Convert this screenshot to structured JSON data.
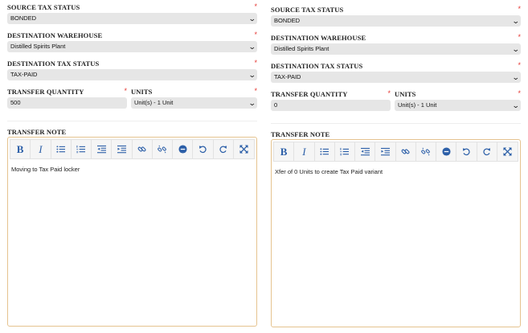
{
  "left": {
    "source_tax_status": {
      "label": "SOURCE TAX STATUS",
      "value": "BONDED"
    },
    "destination_warehouse": {
      "label": "DESTINATION WAREHOUSE",
      "value": "Distilled Spirits Plant"
    },
    "destination_tax_status": {
      "label": "DESTINATION TAX STATUS",
      "value": "TAX-PAID"
    },
    "transfer_quantity": {
      "label": "TRANSFER QUANTITY",
      "value": "500"
    },
    "units": {
      "label": "UNITS",
      "value": "Unit(s) - 1 Unit"
    },
    "transfer_note": {
      "label": "TRANSFER NOTE",
      "content": "Moving to Tax Paid locker"
    }
  },
  "right": {
    "source_tax_status": {
      "label": "SOURCE TAX STATUS",
      "value": "BONDED"
    },
    "destination_warehouse": {
      "label": "DESTINATION WAREHOUSE",
      "value": "Distilled Spirits Plant"
    },
    "destination_tax_status": {
      "label": "DESTINATION TAX STATUS",
      "value": "TAX-PAID"
    },
    "transfer_quantity": {
      "label": "TRANSFER QUANTITY",
      "value": "0"
    },
    "units": {
      "label": "UNITS",
      "value": "Unit(s) - 1 Unit"
    },
    "transfer_note": {
      "label": "TRANSFER NOTE",
      "content": "Xfer of 0 Units to create Tax Paid variant"
    }
  },
  "common": {
    "required_marker": "*",
    "chevron": "⌄",
    "bold_glyph": "B",
    "italic_glyph": "I"
  },
  "colors": {
    "toolbar_icon": "#2c5fa8",
    "required": "#e53935",
    "editor_border": "#e5c38f",
    "field_bg": "#e6e6e6"
  },
  "toolbar_icons": [
    "bold-icon",
    "italic-icon",
    "bullet-list-icon",
    "numbered-list-icon",
    "outdent-icon",
    "indent-icon",
    "link-icon",
    "unlink-icon",
    "remove-format-icon",
    "undo-icon",
    "redo-icon",
    "fullscreen-icon"
  ]
}
